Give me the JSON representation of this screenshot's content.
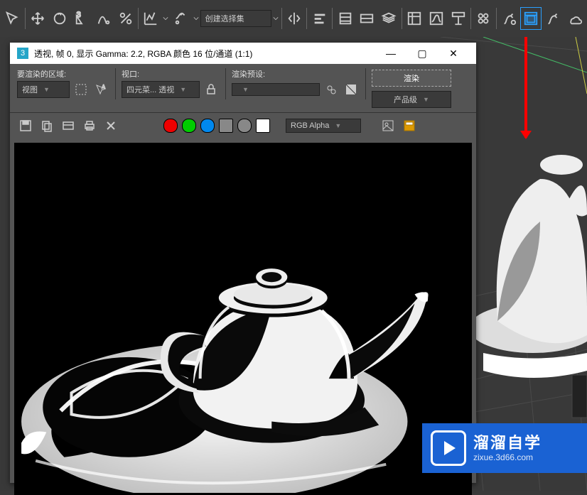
{
  "toolbar": {
    "selection_set": "创建选择集"
  },
  "window": {
    "title": "透视, 帧 0, 显示 Gamma: 2.2, RGBA 颜色 16 位/通道 (1:1)",
    "region_label": "要渲染的区域:",
    "region_dd": "视图",
    "viewport_label": "视口:",
    "viewport_dd": "四元菜... 透视",
    "preset_label": "渲染预设:",
    "preset_dd": "",
    "render_btn": "渲染",
    "prod_dd": "产品级",
    "channel_dd": "RGB Alpha"
  },
  "watermark": {
    "big": "溜溜自学",
    "sm": "zixue.3d66.com"
  }
}
